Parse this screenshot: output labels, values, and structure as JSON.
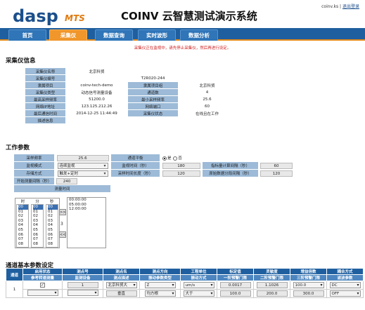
{
  "header": {
    "logo": "dasp",
    "logo_sub": "MTS",
    "title": "COINV 云智慧测试演示系统",
    "user": "coinv.ks",
    "separator": " | ",
    "logout": "退出登录"
  },
  "nav": {
    "tabs": [
      {
        "label": "首页",
        "active": false
      },
      {
        "label": "采集仪",
        "active": true
      },
      {
        "label": "数据查询",
        "active": false
      },
      {
        "label": "实时波形",
        "active": false
      },
      {
        "label": "数据分析",
        "active": false
      }
    ]
  },
  "notice": "采集仪正在监视中，请先停止采集仪，然后再进行设定。",
  "info": {
    "section_title": "采集仪信息",
    "rows": [
      {
        "l1": "采集仪名称",
        "v1": "北京科贸",
        "l2": "",
        "v2": ""
      },
      {
        "l1": "采集仪编号",
        "v1": "",
        "l2": "T2R020-244",
        "v2": ""
      },
      {
        "l1": "隶属项目",
        "v1": "coinv-tech-demo",
        "l2": "隶属项目组",
        "v2": "北京科贸"
      },
      {
        "l1": "采集仪类型",
        "v1": "动态信号测量设备",
        "l2": "通道数",
        "v2": "4"
      },
      {
        "l1": "最高采样频率",
        "v1": "51200.0",
        "l2": "最小采样频率",
        "v2": "25.6"
      },
      {
        "l1": "网络IP地址",
        "v1": "123.125.212.26",
        "l2": "网络端口",
        "v2": "60"
      },
      {
        "l1": "最后通信时间",
        "v1": "2014-12-25 11:44:49",
        "l2": "采集仪状态",
        "v2": "在线且在工作"
      },
      {
        "l1": "描述信息",
        "v1": "",
        "l2": "",
        "v2": ""
      }
    ]
  },
  "params": {
    "section_title": "工作参数",
    "sample_freq_label": "采样频率",
    "sample_freq_value": "25.6",
    "channel_balance_label": "通道平衡",
    "radio_yes": "是",
    "radio_no": "否",
    "monitor_mode_label": "监视模式",
    "monitor_mode_value": "连续监视",
    "monitor_time_label": "监视时间（秒）",
    "monitor_time_value": "180",
    "indicator_interval_label": "指标量计算间隔（秒）",
    "indicator_interval_value": "60",
    "store_mode_label": "存储方式",
    "store_mode_value": "触发+定时",
    "sample_length_label": "采样时间长度（秒）",
    "sample_length_value": "120",
    "raw_save_interval_label": "原始数据分段间隔（秒）",
    "raw_save_interval_value": "120",
    "start_interval_label": "开始测量间隔（秒）",
    "start_interval_value": "240",
    "measure_time_label": "测量时间"
  },
  "time_picker": {
    "h_label": "时",
    "m_label": "分",
    "s_label": "秒",
    "hours": [
      "00",
      "01",
      "02",
      "03",
      "04",
      "05",
      "06",
      "07",
      "08",
      "09"
    ],
    "minutes": [
      "00",
      "01",
      "02",
      "03",
      "04",
      "05",
      "06",
      "07",
      "08",
      "09"
    ],
    "seconds": [
      "00",
      "01",
      "02",
      "03",
      "04",
      "05",
      "06",
      "07",
      "08",
      "09"
    ],
    "add_btn": ">>",
    "remove_btn": "<<",
    "count": "3",
    "selected": [
      "00:00:00",
      "05:00:00",
      "12:00:00"
    ]
  },
  "channels": {
    "section_title": "通道基本参数设定",
    "headers_top": [
      "通道",
      "启用状态",
      "测点号",
      "测点名",
      "测点方向",
      "工程单位",
      "标定值",
      "灵敏度",
      "增益倍数",
      "耦合方式"
    ],
    "headers_sub": [
      "参考转速测量",
      "监测设备",
      "测点描述",
      "振动参数类型",
      "振动方式",
      "一阶预警门限",
      "二阶预警门限",
      "三阶预警门限",
      "滤波参数"
    ],
    "row1": {
      "channel": "1",
      "enabled": "✓",
      "point_no": "1",
      "point_name": "北京科贸大",
      "direction": "Z",
      "unit": "um/s",
      "calib": "0.0017",
      "sensitivity": "1.1026",
      "gain": "100.0",
      "coupling": "DC"
    },
    "row2": {
      "ref": "",
      "device": "",
      "desc": "垂直",
      "vib_type": "均方根",
      "vib_mode": "大于",
      "t1": "100.0",
      "t2": "200.0",
      "t3": "300.0",
      "filter": "OFF"
    }
  }
}
